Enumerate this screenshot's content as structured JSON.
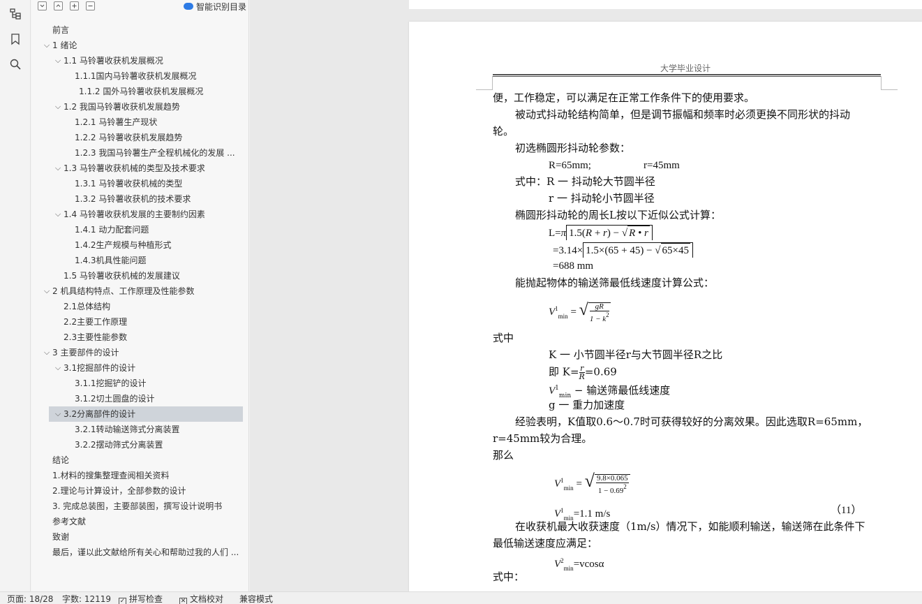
{
  "outline": {
    "smart_toc_label": "智能识别目录",
    "toolbar": {
      "collapse_all": "-",
      "expand_up": "^",
      "expand_all": "+",
      "remove": "-"
    },
    "items": [
      {
        "label": "前言",
        "level": 0,
        "chevron": false
      },
      {
        "label": "1  绪论",
        "level": 0,
        "chevron": true
      },
      {
        "label": "1.1  马铃薯收获机发展概况",
        "level": 1,
        "chevron": true
      },
      {
        "label": "1.1.1国内马铃薯收获机发展概况",
        "level": 2,
        "chevron": false
      },
      {
        "label": "1.1.2  国外马铃薯收获机发展概况",
        "level": 2,
        "chevron": false,
        "extra_indent": true
      },
      {
        "label": "1.2  我国马铃薯收获机发展趋势",
        "level": 1,
        "chevron": true
      },
      {
        "label": "1.2.1  马铃薯生产现状",
        "level": 2,
        "chevron": false
      },
      {
        "label": "1.2.2  马铃薯收获机发展趋势",
        "level": 2,
        "chevron": false
      },
      {
        "label": "1.2.3  我国马铃薯生产全程机械化的发展 ...",
        "level": 2,
        "chevron": false
      },
      {
        "label": "1.3  马铃薯收获机械的类型及技术要求",
        "level": 1,
        "chevron": true
      },
      {
        "label": "1.3.1  马铃薯收获机械的类型",
        "level": 2,
        "chevron": false
      },
      {
        "label": "1.3.2  马铃薯收获机的技术要求",
        "level": 2,
        "chevron": false
      },
      {
        "label": "1.4  马铃薯收获机发展的主要制约因素",
        "level": 1,
        "chevron": true
      },
      {
        "label": "1.4.1  动力配套问题",
        "level": 2,
        "chevron": false
      },
      {
        "label": "1.4.2生产规模与种植形式",
        "level": 2,
        "chevron": false
      },
      {
        "label": "1.4.3机具性能问题",
        "level": 2,
        "chevron": false
      },
      {
        "label": "1.5    马铃薯收获机械的发展建议",
        "level": 1,
        "chevron": false
      },
      {
        "label": "2    机具结构特点、工作原理及性能参数",
        "level": 0,
        "chevron": true
      },
      {
        "label": "2.1总体结构",
        "level": 1,
        "chevron": false
      },
      {
        "label": "2.2主要工作原理",
        "level": 1,
        "chevron": false
      },
      {
        "label": "2.3主要性能参数",
        "level": 1,
        "chevron": false
      },
      {
        "label": "3  主要部件的设计",
        "level": 0,
        "chevron": true
      },
      {
        "label": "3.1挖掘部件的设计",
        "level": 1,
        "chevron": true
      },
      {
        "label": "3.1.1挖掘铲的设计",
        "level": 2,
        "chevron": false
      },
      {
        "label": "3.1.2切土圆盘的设计",
        "level": 2,
        "chevron": false
      },
      {
        "label": "3.2分离部件的设计",
        "level": 1,
        "chevron": true,
        "selected": true
      },
      {
        "label": "3.2.1转动输送筛式分离装置",
        "level": 2,
        "chevron": false
      },
      {
        "label": "3.2.2摆动筛式分离装置",
        "level": 2,
        "chevron": false
      },
      {
        "label": "结论",
        "level": 0,
        "chevron": false
      },
      {
        "label": "1.材料的搜集整理查阅相关资料",
        "level": 0,
        "chevron": false
      },
      {
        "label": "2.理论与计算设计，全部参数的设计",
        "level": 0,
        "chevron": false
      },
      {
        "label": "3. 完成总装图，主要部装图，撰写设计说明书",
        "level": 0,
        "chevron": false
      },
      {
        "label": "参考文献",
        "level": 0,
        "chevron": false
      },
      {
        "label": "致谢",
        "level": 0,
        "chevron": false
      },
      {
        "label": "最后，谨以此文献给所有关心和帮助过我的人们 ...",
        "level": 0,
        "chevron": false
      }
    ]
  },
  "document": {
    "header": "大学毕业设计",
    "l1": "便，工作稳定，可以满足在正常工作条件下的使用要求。",
    "l2": "被动式抖动轮结构简单，但是调节振幅和频率时必须更换不同形状的抖动",
    "l3": "轮。",
    "l4": "初选椭圆形抖动轮参数：",
    "l5a": "R=65mm;",
    "l5b": "r=45mm",
    "l6": "式中：R  一  抖动轮大节圆半径",
    "l7": "r  一  抖动轮小节圆半径",
    "l8": "椭圆形抖动轮的周长L按以下近似公式计算：",
    "l9_lhs": "L=",
    "l9_pi": "π",
    "l9_a": "1.5(",
    "l9_R": "R",
    "l9_b": " + ",
    "l9_r": "r",
    "l9_c": ") − ",
    "l9_sqrt": "R • r",
    "l10_lhs": "=3.14×",
    "l10_a": "1.5×(65 + 45) − ",
    "l10_sqrt": "65×45",
    "l11": "=688 mm",
    "l12": "能抛起物体的输送筛最低线速度计算公式：",
    "f1_V": "V",
    "f1_sup": "1",
    "f1_sub": "min",
    "f1_eq": "=",
    "f1_num": "gR",
    "f1_den": "1 − k",
    "f1_den_sup": "2",
    "l13": "式中",
    "l14": "K  一  小节圆半径r与大节圆半径R之比",
    "l15_a": "即  K=",
    "l15_num": "r",
    "l15_den": "R",
    "l15_b": "=0.69",
    "l16_V": "V",
    "l16_sup": "1",
    "l16_sub": "min",
    "l16_text": "  −  输送筛最低线速度",
    "l17": "g  一  重力加速度",
    "l18": "经验表明，K值取0.6～0.7时可获得较好的分离效果。因此选取R=65mm，",
    "l19": "r=45mm较为合理。",
    "l20": "那么",
    "f2_V": "V",
    "f2_sup": "1",
    "f2_sub": "min",
    "f2_eq": "=",
    "f2_num": "9.8×0.065",
    "f2_den": "1 − 0.69",
    "f2_den_sup": "2",
    "l21_V": "V",
    "l21_sup": "1",
    "l21_sub": "min",
    "l21_val": "=1.1 m/s",
    "l21_eqno": "（11）",
    "l22": "在收获机最大收获速度（1m/s）情况下，如能顺利输送，输送筛在此条件下",
    "l23": "最低输送速度应满足：",
    "l24_V": "V",
    "l24_sup": "2",
    "l24_sub": "min",
    "l24_val": "=vcosα",
    "l25": "式中："
  },
  "status": {
    "page": "页面: 18/28",
    "words": "字数: 12119",
    "spell": "拼写检查",
    "proof": "文档校对",
    "compat": "兼容模式"
  }
}
